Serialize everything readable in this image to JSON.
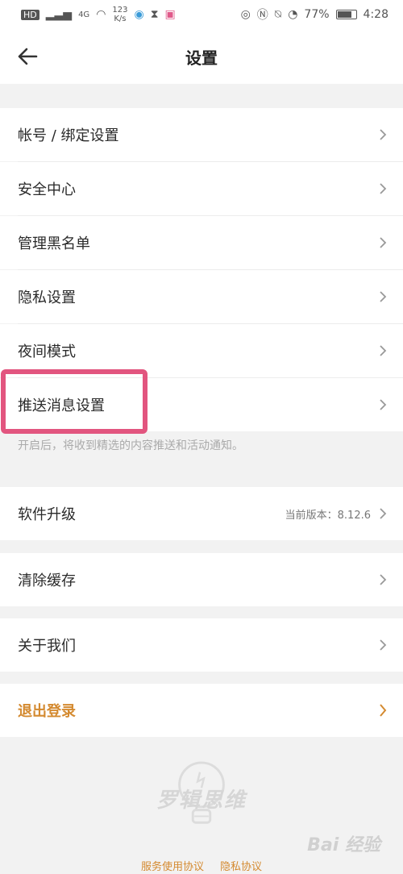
{
  "status_bar": {
    "left_badge": "HD",
    "network": "4G",
    "speed_value": "123",
    "speed_unit": "K/s",
    "battery": "77%",
    "time": "4:28"
  },
  "header": {
    "title": "设置"
  },
  "settings": {
    "account": "帐号 / 绑定设置",
    "security": "安全中心",
    "blacklist": "管理黑名单",
    "privacy": "隐私设置",
    "night_mode": "夜间模式",
    "push": "推送消息设置",
    "push_hint": "开启后，将收到精选的内容推送和活动通知。",
    "upgrade": "软件升级",
    "version": "当前版本：8.12.6",
    "clear_cache": "清除缓存",
    "about": "关于我们",
    "logout": "退出登录"
  },
  "footer": {
    "brand": "罗辑思维",
    "terms": "服务使用协议",
    "privacy": "隐私协议",
    "watermark": "Bai 经验"
  },
  "colors": {
    "accent": "#d48a30",
    "highlight": "#e2557f"
  }
}
